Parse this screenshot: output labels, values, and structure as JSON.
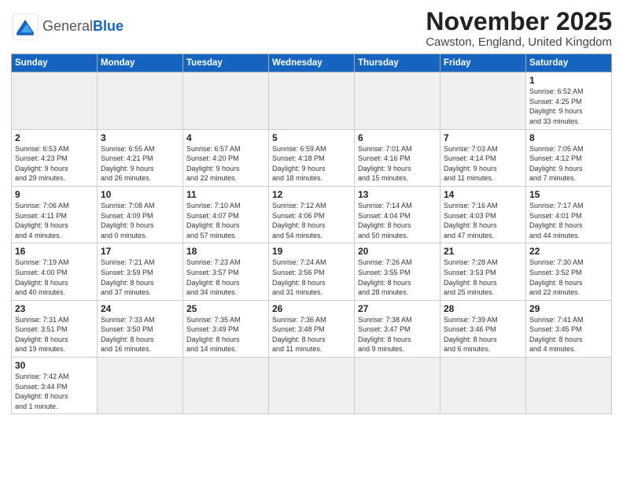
{
  "header": {
    "logo_general": "General",
    "logo_blue": "Blue",
    "title": "November 2025",
    "subtitle": "Cawston, England, United Kingdom"
  },
  "weekdays": [
    "Sunday",
    "Monday",
    "Tuesday",
    "Wednesday",
    "Thursday",
    "Friday",
    "Saturday"
  ],
  "weeks": [
    [
      {
        "day": "",
        "info": ""
      },
      {
        "day": "",
        "info": ""
      },
      {
        "day": "",
        "info": ""
      },
      {
        "day": "",
        "info": ""
      },
      {
        "day": "",
        "info": ""
      },
      {
        "day": "",
        "info": ""
      },
      {
        "day": "1",
        "info": "Sunrise: 6:52 AM\nSunset: 4:25 PM\nDaylight: 9 hours\nand 33 minutes."
      }
    ],
    [
      {
        "day": "2",
        "info": "Sunrise: 6:53 AM\nSunset: 4:23 PM\nDaylight: 9 hours\nand 29 minutes."
      },
      {
        "day": "3",
        "info": "Sunrise: 6:55 AM\nSunset: 4:21 PM\nDaylight: 9 hours\nand 26 minutes."
      },
      {
        "day": "4",
        "info": "Sunrise: 6:57 AM\nSunset: 4:20 PM\nDaylight: 9 hours\nand 22 minutes."
      },
      {
        "day": "5",
        "info": "Sunrise: 6:59 AM\nSunset: 4:18 PM\nDaylight: 9 hours\nand 18 minutes."
      },
      {
        "day": "6",
        "info": "Sunrise: 7:01 AM\nSunset: 4:16 PM\nDaylight: 9 hours\nand 15 minutes."
      },
      {
        "day": "7",
        "info": "Sunrise: 7:03 AM\nSunset: 4:14 PM\nDaylight: 9 hours\nand 11 minutes."
      },
      {
        "day": "8",
        "info": "Sunrise: 7:05 AM\nSunset: 4:12 PM\nDaylight: 9 hours\nand 7 minutes."
      }
    ],
    [
      {
        "day": "9",
        "info": "Sunrise: 7:06 AM\nSunset: 4:11 PM\nDaylight: 9 hours\nand 4 minutes."
      },
      {
        "day": "10",
        "info": "Sunrise: 7:08 AM\nSunset: 4:09 PM\nDaylight: 9 hours\nand 0 minutes."
      },
      {
        "day": "11",
        "info": "Sunrise: 7:10 AM\nSunset: 4:07 PM\nDaylight: 8 hours\nand 57 minutes."
      },
      {
        "day": "12",
        "info": "Sunrise: 7:12 AM\nSunset: 4:06 PM\nDaylight: 8 hours\nand 54 minutes."
      },
      {
        "day": "13",
        "info": "Sunrise: 7:14 AM\nSunset: 4:04 PM\nDaylight: 8 hours\nand 50 minutes."
      },
      {
        "day": "14",
        "info": "Sunrise: 7:16 AM\nSunset: 4:03 PM\nDaylight: 8 hours\nand 47 minutes."
      },
      {
        "day": "15",
        "info": "Sunrise: 7:17 AM\nSunset: 4:01 PM\nDaylight: 8 hours\nand 44 minutes."
      }
    ],
    [
      {
        "day": "16",
        "info": "Sunrise: 7:19 AM\nSunset: 4:00 PM\nDaylight: 8 hours\nand 40 minutes."
      },
      {
        "day": "17",
        "info": "Sunrise: 7:21 AM\nSunset: 3:59 PM\nDaylight: 8 hours\nand 37 minutes."
      },
      {
        "day": "18",
        "info": "Sunrise: 7:23 AM\nSunset: 3:57 PM\nDaylight: 8 hours\nand 34 minutes."
      },
      {
        "day": "19",
        "info": "Sunrise: 7:24 AM\nSunset: 3:56 PM\nDaylight: 8 hours\nand 31 minutes."
      },
      {
        "day": "20",
        "info": "Sunrise: 7:26 AM\nSunset: 3:55 PM\nDaylight: 8 hours\nand 28 minutes."
      },
      {
        "day": "21",
        "info": "Sunrise: 7:28 AM\nSunset: 3:53 PM\nDaylight: 8 hours\nand 25 minutes."
      },
      {
        "day": "22",
        "info": "Sunrise: 7:30 AM\nSunset: 3:52 PM\nDaylight: 8 hours\nand 22 minutes."
      }
    ],
    [
      {
        "day": "23",
        "info": "Sunrise: 7:31 AM\nSunset: 3:51 PM\nDaylight: 8 hours\nand 19 minutes."
      },
      {
        "day": "24",
        "info": "Sunrise: 7:33 AM\nSunset: 3:50 PM\nDaylight: 8 hours\nand 16 minutes."
      },
      {
        "day": "25",
        "info": "Sunrise: 7:35 AM\nSunset: 3:49 PM\nDaylight: 8 hours\nand 14 minutes."
      },
      {
        "day": "26",
        "info": "Sunrise: 7:36 AM\nSunset: 3:48 PM\nDaylight: 8 hours\nand 11 minutes."
      },
      {
        "day": "27",
        "info": "Sunrise: 7:38 AM\nSunset: 3:47 PM\nDaylight: 8 hours\nand 9 minutes."
      },
      {
        "day": "28",
        "info": "Sunrise: 7:39 AM\nSunset: 3:46 PM\nDaylight: 8 hours\nand 6 minutes."
      },
      {
        "day": "29",
        "info": "Sunrise: 7:41 AM\nSunset: 3:45 PM\nDaylight: 8 hours\nand 4 minutes."
      }
    ],
    [
      {
        "day": "30",
        "info": "Sunrise: 7:42 AM\nSunset: 3:44 PM\nDaylight: 8 hours\nand 1 minute."
      },
      {
        "day": "",
        "info": ""
      },
      {
        "day": "",
        "info": ""
      },
      {
        "day": "",
        "info": ""
      },
      {
        "day": "",
        "info": ""
      },
      {
        "day": "",
        "info": ""
      },
      {
        "day": "",
        "info": ""
      }
    ]
  ]
}
